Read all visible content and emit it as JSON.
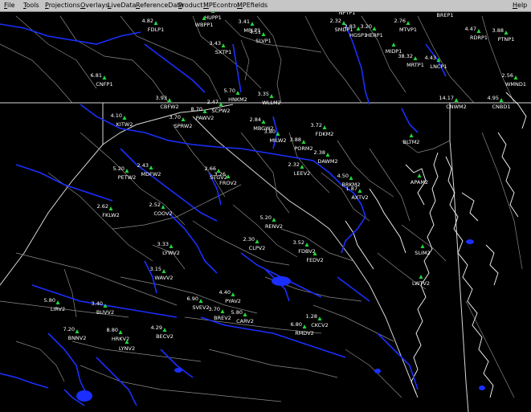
{
  "menubar": {
    "items": [
      "File",
      "Tools",
      "Projections",
      "Overlays",
      "LiveData",
      "ReferenceData",
      "Product",
      "MPEcontrol",
      "MPEfields"
    ],
    "help": "Help"
  },
  "colors": {
    "rivers": "#1a2fff",
    "borders": "#c8c8c8",
    "labels": "#ffffff",
    "gauge_marker": "#22d63a"
  },
  "stations": [
    {
      "id": "FDLP1",
      "value": "4.82"
    },
    {
      "id": "HUPP1",
      "value": "4.64"
    },
    {
      "id": "WBPP1",
      "value": ""
    },
    {
      "id": "MPLP1",
      "value": "3.41"
    },
    {
      "id": "SLVP1",
      "value": "4.51"
    },
    {
      "id": "SXTP1",
      "value": "3.43"
    },
    {
      "id": "NPTP1",
      "value": "5.80"
    },
    {
      "id": "SMDP1",
      "value": "2.32"
    },
    {
      "id": "HGSP1",
      "value": "2.83"
    },
    {
      "id": "HERP1",
      "value": "3.20"
    },
    {
      "id": "MIDP1",
      "value": ""
    },
    {
      "id": "MTVP1",
      "value": "2.76"
    },
    {
      "id": "MRTP1",
      "value": "38.32"
    },
    {
      "id": "LNCP1",
      "value": "4.43"
    },
    {
      "id": "RDRP1",
      "value": "4.47"
    },
    {
      "id": "BREP1",
      "value": ""
    },
    {
      "id": "PTNP1",
      "value": "3.88"
    },
    {
      "id": "CNFP1",
      "value": "6.81"
    },
    {
      "id": "CBFW2",
      "value": "3.93"
    },
    {
      "id": "PAWV2",
      "value": "8.70"
    },
    {
      "id": "SCPW2",
      "value": "2.47"
    },
    {
      "id": "HNKM2",
      "value": "5.70"
    },
    {
      "id": "WLLM2",
      "value": "3.35"
    },
    {
      "id": "MBGW2",
      "value": "2.84"
    },
    {
      "id": "MILW2",
      "value": "3.80"
    },
    {
      "id": "FDKM2",
      "value": "3.72"
    },
    {
      "id": "PORM2",
      "value": "3.88"
    },
    {
      "id": "DAWM2",
      "value": "2.38"
    },
    {
      "id": "BLTM2",
      "value": ""
    },
    {
      "id": "CNWM2",
      "value": "14.17"
    },
    {
      "id": "CNBD1",
      "value": "4.95"
    },
    {
      "id": "WMND1",
      "value": "2.56"
    },
    {
      "id": "KITW2",
      "value": "4.10"
    },
    {
      "id": "SPRW2",
      "value": "3.70"
    },
    {
      "id": "PETW2",
      "value": "5.20"
    },
    {
      "id": "MDFW2",
      "value": "2.43"
    },
    {
      "id": "STGV2",
      "value": "2.66"
    },
    {
      "id": "FROV2",
      "value": "3.26"
    },
    {
      "id": "LEEV2",
      "value": "2.32"
    },
    {
      "id": "BRKM2",
      "value": "4.50"
    },
    {
      "id": "AXTV2",
      "value": "1.87"
    },
    {
      "id": "APAM2",
      "value": ""
    },
    {
      "id": "FKLW2",
      "value": "2.62"
    },
    {
      "id": "COOV2",
      "value": "2.52"
    },
    {
      "id": "RENV2",
      "value": "5.20"
    },
    {
      "id": "LYWV2",
      "value": "3.33"
    },
    {
      "id": "CLPV2",
      "value": "2.30"
    },
    {
      "id": "FDBV2",
      "value": "3.52"
    },
    {
      "id": "FEDV2",
      "value": ""
    },
    {
      "id": "SLIM2",
      "value": ""
    },
    {
      "id": "WAVV2",
      "value": "3.15"
    },
    {
      "id": "LWTV2",
      "value": ""
    },
    {
      "id": "LIRV2",
      "value": "5.80"
    },
    {
      "id": "BUVV2",
      "value": "3.40"
    },
    {
      "id": "PYAV2",
      "value": "4.40"
    },
    {
      "id": "SVEV2",
      "value": "6.90"
    },
    {
      "id": "BREV2",
      "value": "3.70"
    },
    {
      "id": "CARV2",
      "value": "5.80"
    },
    {
      "id": "BNNV2",
      "value": "7.20"
    },
    {
      "id": "HRKV2",
      "value": "8.80"
    },
    {
      "id": "BECV2",
      "value": "4.29"
    },
    {
      "id": "LYNV2",
      "value": ""
    },
    {
      "id": "RMDV2",
      "value": "6.80"
    },
    {
      "id": "CKCV2",
      "value": "1.28"
    }
  ]
}
